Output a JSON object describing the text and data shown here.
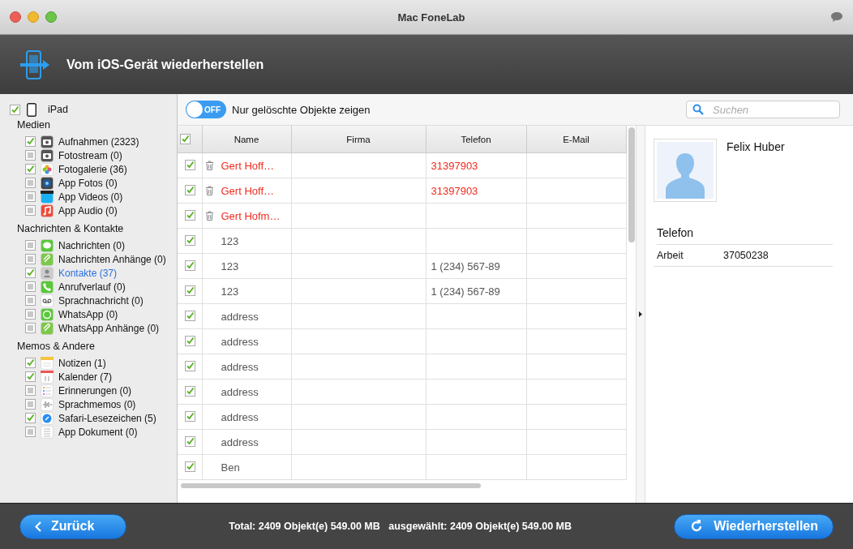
{
  "window": {
    "title": "Mac FoneLab"
  },
  "header": {
    "title": "Vom iOS-Gerät wiederherstellen"
  },
  "sidebar": {
    "device": {
      "label": "iPad",
      "checked": true
    },
    "groups": [
      {
        "title": "Medien",
        "items": [
          {
            "label": "Aufnahmen (2323)",
            "kind": "camera",
            "checked": true,
            "selected": false
          },
          {
            "label": "Fotostream (0)",
            "kind": "camera",
            "checked": false,
            "selected": false
          },
          {
            "label": "Fotogalerie (36)",
            "kind": "photos",
            "checked": true,
            "selected": false
          },
          {
            "label": "App Fotos (0)",
            "kind": "lens",
            "checked": false,
            "selected": false
          },
          {
            "label": "App Videos (0)",
            "kind": "clapper",
            "checked": false,
            "selected": false
          },
          {
            "label": "App Audio (0)",
            "kind": "music",
            "checked": false,
            "selected": false
          }
        ]
      },
      {
        "title": "Nachrichten & Kontakte",
        "items": [
          {
            "label": "Nachrichten (0)",
            "kind": "bubble",
            "checked": false,
            "selected": false
          },
          {
            "label": "Nachrichten Anhänge (0)",
            "kind": "paperclip",
            "checked": false,
            "selected": false
          },
          {
            "label": "Kontakte (37)",
            "kind": "contacts",
            "checked": true,
            "selected": true
          },
          {
            "label": "Anrufverlauf (0)",
            "kind": "phone",
            "checked": false,
            "selected": false
          },
          {
            "label": "Sprachnachricht (0)",
            "kind": "voicemail",
            "checked": false,
            "selected": false
          },
          {
            "label": "WhatsApp (0)",
            "kind": "whatsapp",
            "checked": false,
            "selected": false
          },
          {
            "label": "WhatsApp Anhänge (0)",
            "kind": "paperclip",
            "checked": false,
            "selected": false
          }
        ]
      },
      {
        "title": "Memos & Andere",
        "items": [
          {
            "label": "Notizen (1)",
            "kind": "notes",
            "checked": true,
            "selected": false
          },
          {
            "label": "Kalender (7)",
            "kind": "calendar",
            "checked": true,
            "selected": false
          },
          {
            "label": "Erinnerungen (0)",
            "kind": "list",
            "checked": false,
            "selected": false
          },
          {
            "label": "Sprachmemos (0)",
            "kind": "waveform",
            "checked": false,
            "selected": false
          },
          {
            "label": "Safari-Lesezeichen (5)",
            "kind": "compass",
            "checked": true,
            "selected": false
          },
          {
            "label": "App Dokument (0)",
            "kind": "document",
            "checked": false,
            "selected": false
          }
        ]
      }
    ]
  },
  "toolbar": {
    "toggle": {
      "label": "OFF",
      "on": false
    },
    "toggle_caption": "Nur gelöschte Objekte zeigen",
    "search": {
      "placeholder": "Suchen"
    }
  },
  "table": {
    "all_checked": true,
    "columns": [
      "Name",
      "Firma",
      "Telefon",
      "E-Mail"
    ],
    "rows": [
      {
        "checked": true,
        "deleted": true,
        "name": "Gert Hoff…",
        "phone": "31397903"
      },
      {
        "checked": true,
        "deleted": true,
        "name": "Gert Hoff…",
        "phone": "31397903"
      },
      {
        "checked": true,
        "deleted": true,
        "name": "Gert Hofm…",
        "phone": ""
      },
      {
        "checked": true,
        "deleted": false,
        "name": "123",
        "phone": ""
      },
      {
        "checked": true,
        "deleted": false,
        "name": "123",
        "phone": "1 (234) 567-89"
      },
      {
        "checked": true,
        "deleted": false,
        "name": "123",
        "phone": "1 (234) 567-89"
      },
      {
        "checked": true,
        "deleted": false,
        "name": "address",
        "phone": ""
      },
      {
        "checked": true,
        "deleted": false,
        "name": "address",
        "phone": ""
      },
      {
        "checked": true,
        "deleted": false,
        "name": "address",
        "phone": ""
      },
      {
        "checked": true,
        "deleted": false,
        "name": "address",
        "phone": ""
      },
      {
        "checked": true,
        "deleted": false,
        "name": "address",
        "phone": ""
      },
      {
        "checked": true,
        "deleted": false,
        "name": "address",
        "phone": ""
      },
      {
        "checked": true,
        "deleted": false,
        "name": "Ben",
        "phone": ""
      }
    ]
  },
  "detail": {
    "name": "Felix Huber",
    "section": "Telefon",
    "fields": [
      {
        "label": "Arbeit",
        "value": "37050238"
      }
    ]
  },
  "footer": {
    "back": "Zurück",
    "status": "Total: 2409 Objekt(e) 549.00 MB   ausgewählt: 2409 Objekt(e) 549.00 MB",
    "restore": "Wiederherstellen"
  }
}
